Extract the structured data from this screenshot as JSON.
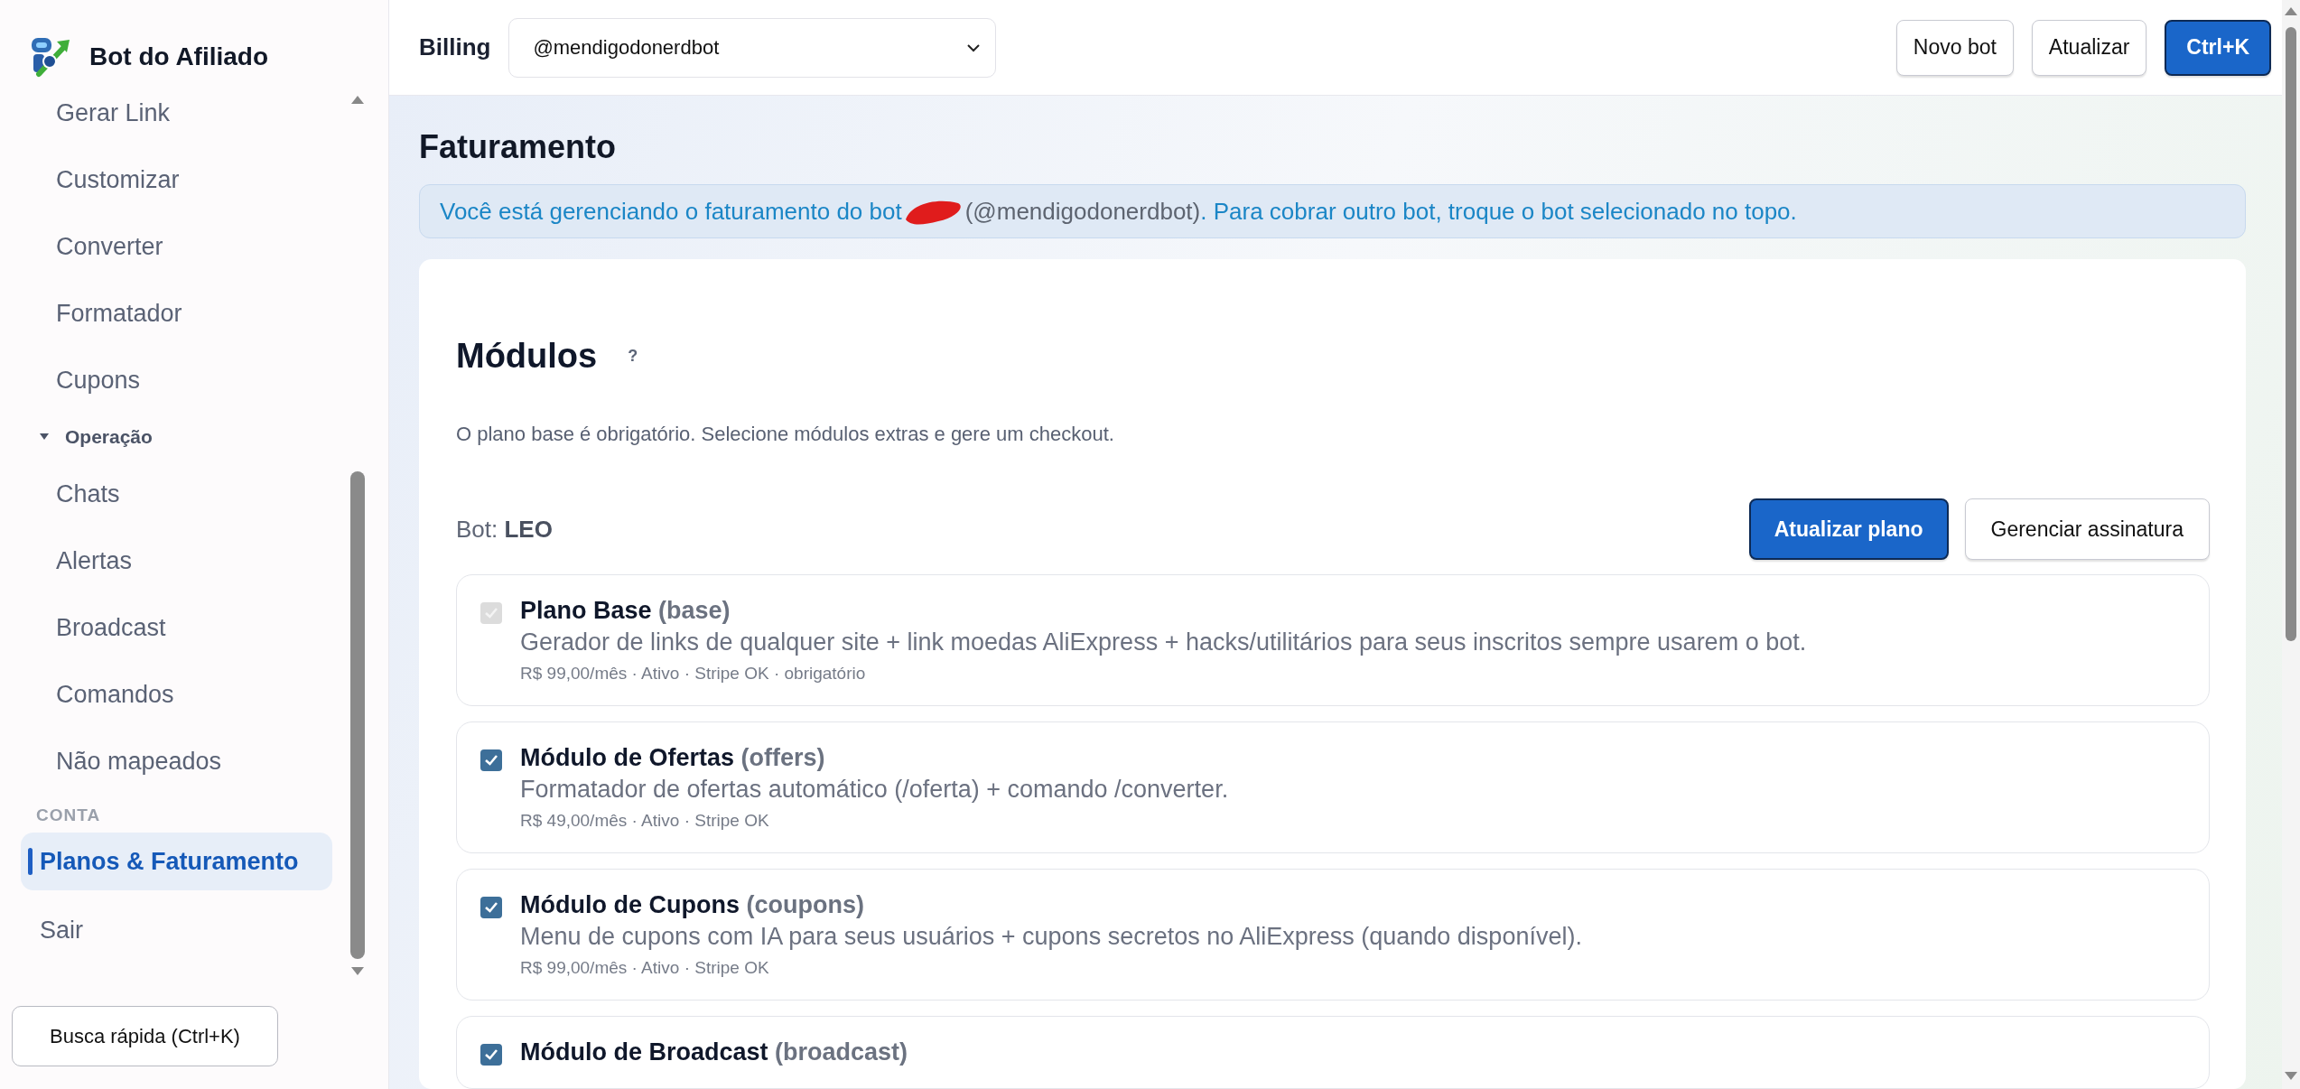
{
  "sidebar": {
    "brand": "Bot do Afiliado",
    "items": [
      {
        "kind": "link",
        "label": "Gerar Link",
        "selected": false
      },
      {
        "kind": "link",
        "label": "Customizar",
        "selected": false
      },
      {
        "kind": "link",
        "label": "Converter",
        "selected": false
      },
      {
        "kind": "link",
        "label": "Formatador",
        "selected": false
      },
      {
        "kind": "link",
        "label": "Cupons",
        "selected": false
      },
      {
        "kind": "group",
        "label": "Operação",
        "expanded": true,
        "children": [
          {
            "label": "Chats",
            "selected": false
          },
          {
            "label": "Alertas",
            "selected": false
          },
          {
            "label": "Broadcast",
            "selected": false
          },
          {
            "label": "Comandos",
            "selected": false
          },
          {
            "label": "Não mapeados",
            "selected": false
          }
        ]
      },
      {
        "kind": "heading",
        "label": "CONTA"
      },
      {
        "kind": "account",
        "label": "Planos & Faturamento",
        "selected": true
      },
      {
        "kind": "account",
        "label": "Sair",
        "selected": false
      }
    ],
    "quick_search": "Busca rápida (Ctrl+K)"
  },
  "topbar": {
    "label": "Billing",
    "bot_select": "@mendigodonerdbot",
    "buttons": [
      {
        "label": "Novo bot",
        "primary": false
      },
      {
        "label": "Atualizar",
        "primary": false
      },
      {
        "label": "Ctrl+K",
        "primary": true
      }
    ]
  },
  "page": {
    "title": "Faturamento",
    "banner": {
      "before": "Você está gerenciando o faturamento do bot",
      "redacted": true,
      "handle": "(@mendigodonerdbot)",
      "after": ". Para cobrar outro bot, troque o bot selecionado no topo."
    },
    "modules": {
      "title": "Módulos",
      "help": "?",
      "description": "O plano base é obrigatório. Selecione módulos extras e gere um checkout.",
      "bot": "Bot: **LEO**",
      "buttons": [
        {
          "label": "Atualizar plano",
          "primary": true
        },
        {
          "label": "Gerenciar assinatura",
          "primary": false
        }
      ],
      "items": [
        {
          "name": "Plano Base",
          "code": "(base)",
          "description": "Gerador de links de qualquer site + link moedas AliExpress + hacks/utilitários para seus inscritos sempre usarem o bot.",
          "meta": "R$ 99,00/mês · Ativo · Stripe OK · obrigatório",
          "checked": true,
          "disabled": true
        },
        {
          "name": "Módulo de Ofertas",
          "code": "(offers)",
          "description": "Formatador de ofertas automático (/oferta) + comando /converter.",
          "meta": "R$ 49,00/mês · Ativo · Stripe OK",
          "checked": true,
          "disabled": false
        },
        {
          "name": "Módulo de Cupons",
          "code": "(coupons)",
          "description": "Menu de cupons com IA para seus usuários + cupons secretos no AliExpress (quando disponível).",
          "meta": "R$ 99,00/mês · Ativo · Stripe OK",
          "checked": true,
          "disabled": false
        },
        {
          "name": "Módulo de Broadcast",
          "code": "(broadcast)",
          "checked": true,
          "disabled": false
        }
      ]
    }
  }
}
